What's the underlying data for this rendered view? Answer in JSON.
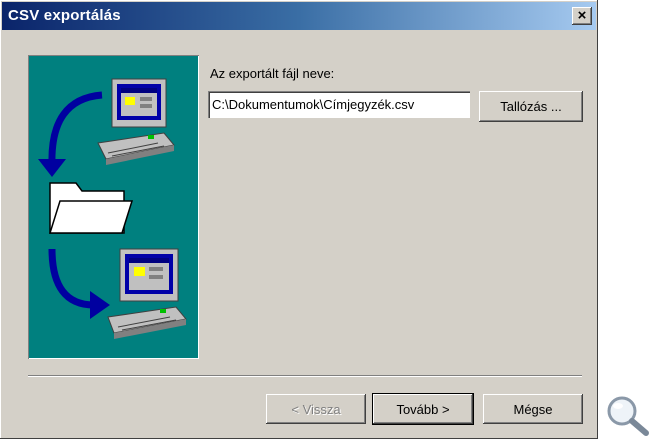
{
  "window": {
    "title": "CSV exportálás",
    "close_label": "×"
  },
  "form": {
    "filename_label": "Az exportált fájl neve:",
    "filename_value": "C:\\Dokumentumok\\Címjegyzék.csv",
    "browse_label": "Tallózás ..."
  },
  "footer": {
    "back_label": "< Vissza",
    "next_label": "Tovább >",
    "cancel_label": "Mégse",
    "back_enabled": false
  },
  "icons": {
    "illustration": "export-wizard-illustration",
    "zoom": "magnifier-icon"
  },
  "colors": {
    "titlebar_start": "#0a246a",
    "titlebar_end": "#a6caf0",
    "illustration_bg": "#00807f",
    "dialog_bg": "#d4d0c8"
  }
}
